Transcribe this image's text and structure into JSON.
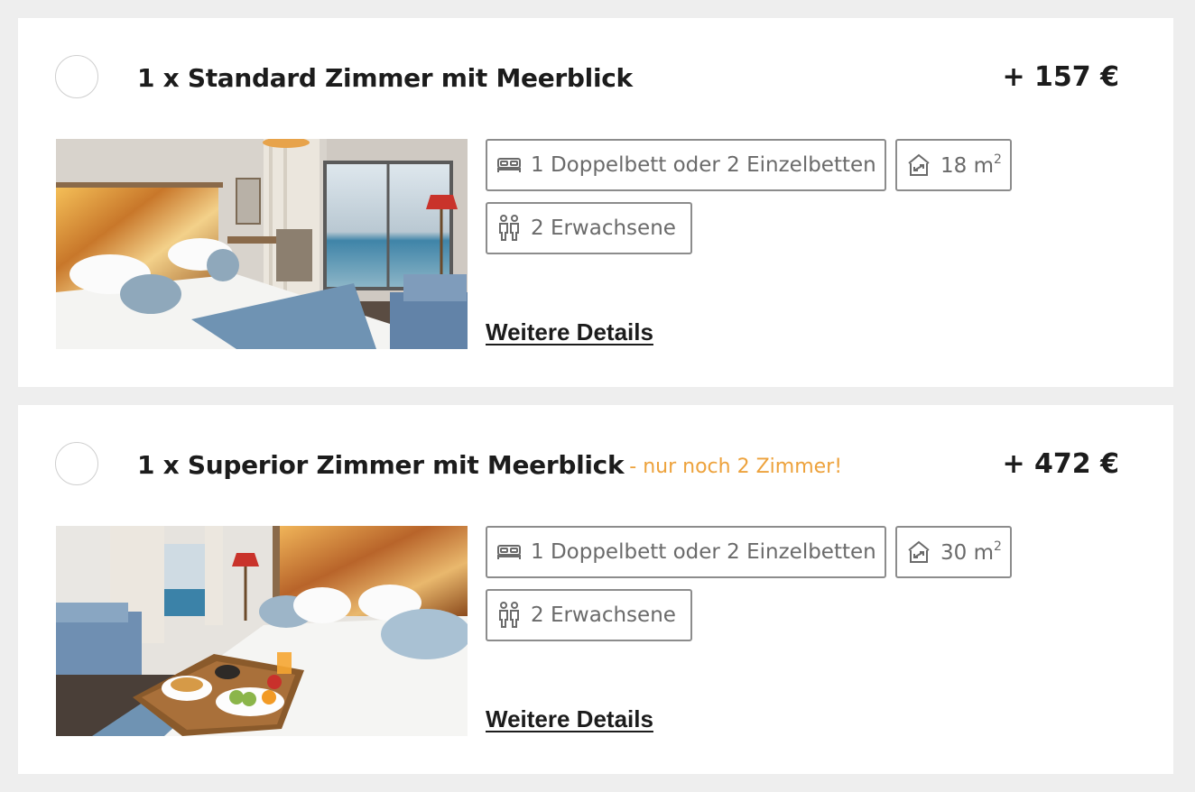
{
  "rooms": [
    {
      "title": "1 x Standard Zimmer mit Meerblick",
      "availability": "",
      "price": "+ 157 €",
      "bed": "1 Doppelbett oder 2 Einzelbetten",
      "size_value": "18 m",
      "size_unit_sup": "2",
      "persons": "2 Erwachsene",
      "details_link": "Weitere Details",
      "icons": [
        "bed-icon",
        "room-size-icon",
        "persons-icon"
      ]
    },
    {
      "title": "1 x Superior Zimmer mit Meerblick",
      "availability": "- nur noch 2 Zimmer!",
      "price": "+ 472 €",
      "bed": "1 Doppelbett oder 2 Einzelbetten",
      "size_value": "30 m",
      "size_unit_sup": "2",
      "persons": "2 Erwachsene",
      "details_link": "Weitere Details",
      "icons": [
        "bed-icon",
        "room-size-icon",
        "persons-icon"
      ]
    }
  ],
  "colors": {
    "page_background": "#eeeeee",
    "card_background": "#ffffff",
    "availability_accent": "#eda23c",
    "chip_border": "#8c8c8c",
    "text_dark": "#1c1c1c",
    "text_muted": "#6a6a6a"
  }
}
